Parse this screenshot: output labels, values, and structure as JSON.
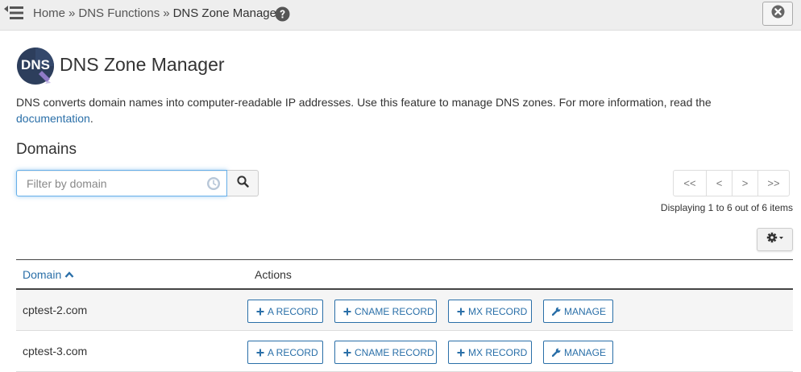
{
  "breadcrumb": {
    "home": "Home",
    "separator": "»",
    "section": "DNS Functions",
    "current": "DNS Zone Manager"
  },
  "header": {
    "logo_text": "DNS",
    "title": "DNS Zone Manager",
    "description": "DNS converts domain names into computer-readable IP addresses. Use this feature to manage DNS zones. For more information, read the",
    "doc_link": "documentation",
    "doc_suffix": "."
  },
  "domains": {
    "title": "Domains",
    "search_placeholder": "Filter by domain",
    "pager": {
      "first": "<<",
      "prev": "<",
      "next": ">",
      "last": ">>"
    },
    "display_info": "Displaying 1 to 6 out of 6 items",
    "columns": {
      "domain": "Domain",
      "actions": "Actions"
    },
    "action_labels": {
      "a_record": "A RECORD",
      "cname_record": "CNAME RECORD",
      "mx_record": "MX RECORD",
      "manage": "MANAGE"
    },
    "rows": [
      {
        "domain": "cptest-2.com"
      },
      {
        "domain": "cptest-3.com"
      }
    ]
  },
  "colors": {
    "accent": "#2a6fa8",
    "topbar": "#eeeeee"
  },
  "icons": {
    "menu": "menu-toggle-icon",
    "help": "question-circle-icon",
    "close": "close-circle-icon",
    "search": "search-icon",
    "clock": "clock-icon",
    "gear": "gear-icon",
    "plus": "plus-icon",
    "wrench": "wrench-icon",
    "sort": "chevron-up-icon"
  }
}
